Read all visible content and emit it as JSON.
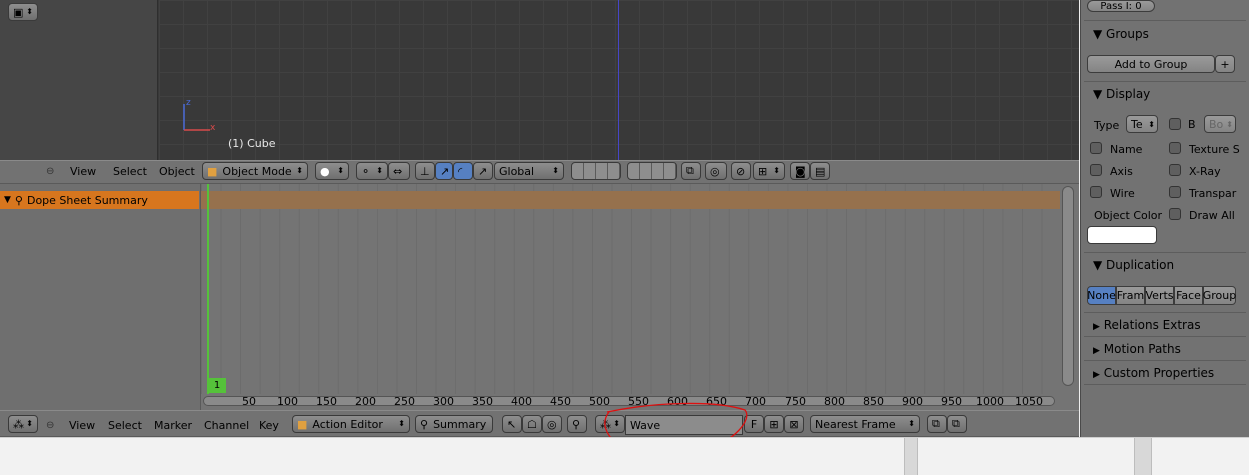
{
  "viewport": {
    "object_label": "(1) Cube",
    "axis_z": "z",
    "axis_x": "x"
  },
  "view3d_header": {
    "menus": [
      "View",
      "Select",
      "Object"
    ],
    "mode": "Object Mode",
    "orientation": "Global"
  },
  "dopesheet": {
    "channel_summary": "Dope Sheet Summary",
    "current_frame": "1",
    "ticks": [
      "50",
      "100",
      "150",
      "200",
      "250",
      "300",
      "350",
      "400",
      "450",
      "500",
      "550",
      "600",
      "650",
      "700",
      "750",
      "800",
      "850",
      "900",
      "950",
      "1000",
      "1050"
    ]
  },
  "dopesheet_header": {
    "menus": [
      "View",
      "Select",
      "Marker",
      "Channel",
      "Key"
    ],
    "mode": "Action Editor",
    "summary_button": "Summary",
    "action_name": "Wave",
    "fake_user": "F",
    "snap_mode": "Nearest Frame"
  },
  "properties": {
    "pass_index": "Pass I: 0",
    "groups": {
      "title": "Groups",
      "add_button": "Add to Group"
    },
    "display": {
      "title": "Display",
      "type_label": "Type",
      "type_value": "Te",
      "b_label": "B",
      "bo_value": "Bo",
      "name": "Name",
      "texture_space": "Texture S",
      "axis": "Axis",
      "xray": "X-Ray",
      "wire": "Wire",
      "transparent": "Transpar",
      "object_color": "Object Color",
      "draw_all": "Draw All"
    },
    "duplication": {
      "title": "Duplication",
      "options": [
        "None",
        "Fram",
        "Verts",
        "Face",
        "Group"
      ],
      "active": "None"
    },
    "collapsed_panels": [
      "Relations Extras",
      "Motion Paths",
      "Custom Properties"
    ]
  },
  "colors": {
    "summary_orange": "#d7761e",
    "playhead_green": "#55c23a",
    "active_blue": "#5680c2"
  }
}
